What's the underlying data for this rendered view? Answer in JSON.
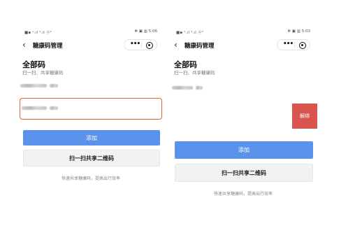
{
  "screens": [
    {
      "status": {
        "left": "■▪ ᵉ.ıl ⁴.ıl ⓐ²",
        "right": "✻ ▣ ▥ 5:06"
      },
      "nav": {
        "back": "‹",
        "title": "糖康码管理",
        "more": "•••"
      },
      "section": {
        "title": "全部码",
        "subtitle": "扫一扫、共享糖康码"
      },
      "buttons": {
        "add": "添加",
        "scan": "扫一扫共享二维码"
      },
      "hint": "快速共享糖康码，提高出行效率"
    },
    {
      "status": {
        "left": "■▪ ᵉ.ıl ⁴.ıl ⓐ²",
        "right": "✻ ▣ ▥ 5:03"
      },
      "nav": {
        "back": "‹",
        "title": "糖康码管理",
        "more": "•••"
      },
      "section": {
        "title": "全部码",
        "subtitle": "扫一扫、共享糖康码"
      },
      "swipe_action": "解绑",
      "buttons": {
        "add": "添加",
        "scan": "扫一扫共享二维码"
      },
      "hint": "快速共享糖康码，提高出行效率"
    }
  ],
  "colors": {
    "primary": "#5b93ec",
    "highlight_border": "#e2652f",
    "danger": "#d9534f"
  }
}
